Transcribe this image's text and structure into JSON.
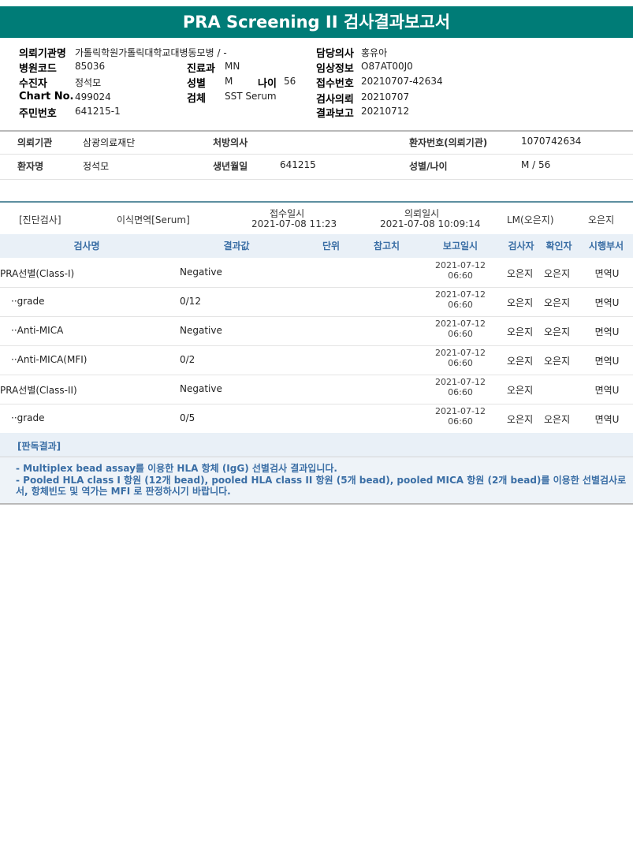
{
  "title": "PRA Screening II 검사결과보고서",
  "header": {
    "req_org_label": "의뢰기관명",
    "req_org": "가톨릭학원가톨릭대학교대병동모병 / -",
    "hosp_code_label": "병원코드",
    "hosp_code": "85036",
    "recipient_label": "수진자",
    "recipient": "정석모",
    "chart_label": "Chart No.",
    "chart": "499024",
    "rrn_label": "주민번호",
    "rrn": "641215-1",
    "dept_label": "진료과",
    "dept": "MN",
    "sex_label": "성별",
    "sex": "M",
    "age_label": "나이",
    "age": "56",
    "specimen_label": "검체",
    "specimen": "SST Serum",
    "doctor_label": "담당의사",
    "doctor": "홍유아",
    "clinical_label": "임상정보",
    "clinical": "O87AT00J0",
    "recv_no_label": "접수번호",
    "recv_no": "20210707-42634",
    "test_req_label": "검사의뢰",
    "test_req": "20210707",
    "result_rep_label": "결과보고",
    "result_rep": "20210712"
  },
  "patient": {
    "org_label": "의뢰기관",
    "org": "삼광의료재단",
    "prescriber_label": "처방의사",
    "prescriber": "",
    "patno_label": "환자번호(의뢰기관)",
    "patno": "1070742634",
    "name_label": "환자명",
    "name": "정석모",
    "dob_label": "생년월일",
    "dob": "641215",
    "sexage_label": "성별/나이",
    "sexage": "M / 56"
  },
  "order": {
    "category": "[진단검사]",
    "dept": "이식면역[Serum]",
    "recv_label": "접수일시",
    "recv": "2021-07-08  11:23",
    "req_label": "의뢰일시",
    "req": "2021-07-08  10:09:14",
    "lm": "LM(오은지)",
    "staff": "오은지"
  },
  "table": {
    "headers": [
      "검사명",
      "결과값",
      "단위",
      "참고치",
      "보고일시",
      "검사자",
      "확인자",
      "시행부서"
    ],
    "rows": [
      {
        "name": "PRA선별(Class-I)",
        "value": "Negative",
        "date": "2021-07-12",
        "time": "06:60",
        "examiner": "오은지",
        "checker": "오은지",
        "dept": "면역U"
      },
      {
        "name": "··grade",
        "value": "0/12",
        "date": "2021-07-12",
        "time": "06:60",
        "examiner": "오은지",
        "checker": "오은지",
        "dept": "면역U"
      },
      {
        "name": "··Anti-MICA",
        "value": "Negative",
        "date": "2021-07-12",
        "time": "06:60",
        "examiner": "오은지",
        "checker": "오은지",
        "dept": "면역U"
      },
      {
        "name": "··Anti-MICA(MFI)",
        "value": "0/2",
        "date": "2021-07-12",
        "time": "06:60",
        "examiner": "오은지",
        "checker": "오은지",
        "dept": "면역U"
      },
      {
        "name": "PRA선별(Class-II)",
        "value": "Negative",
        "date": "2021-07-12",
        "time": "06:60",
        "examiner": "오은지",
        "checker": "",
        "dept": "면역U"
      },
      {
        "name": "··grade",
        "value": "0/5",
        "date": "2021-07-12",
        "time": "06:60",
        "examiner": "오은지",
        "checker": "오은지",
        "dept": "면역U"
      }
    ]
  },
  "interpretation": {
    "label": "[판독결과]",
    "lines": [
      "- Multiplex bead assay를 이용한 HLA 항체 (IgG) 선별검사 결과입니다.",
      "- Pooled HLA class I 항원 (12개 bead), pooled HLA class II 항원 (5개 bead), pooled MICA 항원 (2개 bead)를 이용한 선별검사로서, 항체빈도 및 역가는 MFI 로 판정하시기 바랍니다."
    ]
  }
}
